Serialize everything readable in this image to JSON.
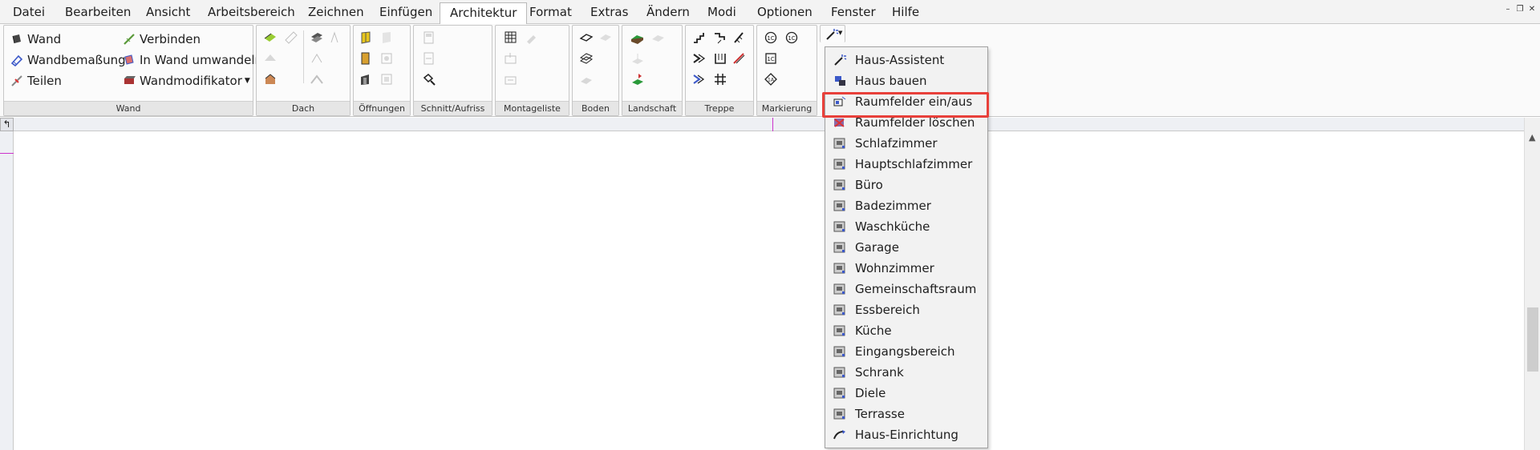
{
  "menubar": {
    "items": [
      "Datei",
      "Bearbeiten",
      "Ansicht",
      "Arbeitsbereich",
      "Zeichnen",
      "Einfügen",
      "Architektur",
      "Format",
      "Extras",
      "Ändern",
      "Modi",
      "Optionen",
      "Fenster",
      "Hilfe"
    ],
    "active": "Architektur"
  },
  "ribbon": {
    "wand": {
      "label": "Wand",
      "wand": "Wand",
      "wandbemassung": "Wandbemaßung",
      "teilen": "Teilen",
      "verbinden": "Verbinden",
      "in_wand_umwandeln": "In Wand umwandeln",
      "wandmodifikator": "Wandmodifikator"
    },
    "groups": {
      "dach": "Dach",
      "oeffnungen": "Öffnungen",
      "schnitt": "Schnitt/Aufriss",
      "montageliste": "Montageliste",
      "boden": "Boden",
      "landschaft": "Landschaft",
      "treppe": "Treppe",
      "markierung": "Markierung"
    }
  },
  "dropdown": {
    "items": [
      {
        "label": "Haus-Assistent",
        "icon": "wand-magic-icon"
      },
      {
        "label": "Haus bauen",
        "icon": "house-build-icon"
      },
      {
        "label": "Raumfelder ein/aus",
        "icon": "room-toggle-icon"
      },
      {
        "label": "Raumfelder löschen",
        "icon": "room-delete-icon"
      },
      {
        "label": "Schlafzimmer",
        "icon": "room-label-icon"
      },
      {
        "label": "Hauptschlafzimmer",
        "icon": "room-label-icon"
      },
      {
        "label": "Büro",
        "icon": "room-label-icon"
      },
      {
        "label": "Badezimmer",
        "icon": "room-label-icon"
      },
      {
        "label": "Waschküche",
        "icon": "room-label-icon"
      },
      {
        "label": "Garage",
        "icon": "room-label-icon"
      },
      {
        "label": "Wohnzimmer",
        "icon": "room-label-icon"
      },
      {
        "label": "Gemeinschaftsraum",
        "icon": "room-label-icon"
      },
      {
        "label": "Essbereich",
        "icon": "room-label-icon"
      },
      {
        "label": "Küche",
        "icon": "room-label-icon"
      },
      {
        "label": "Eingangsbereich",
        "icon": "room-label-icon"
      },
      {
        "label": "Schrank",
        "icon": "room-label-icon"
      },
      {
        "label": "Diele",
        "icon": "room-label-icon"
      },
      {
        "label": "Terrasse",
        "icon": "room-label-icon"
      },
      {
        "label": "Haus-Einrichtung",
        "icon": "house-setup-icon"
      }
    ],
    "highlighted": "Raumfelder ein/aus"
  },
  "colors": {
    "highlight_border": "#e8403a",
    "guide_magenta": "#cc33cc"
  }
}
